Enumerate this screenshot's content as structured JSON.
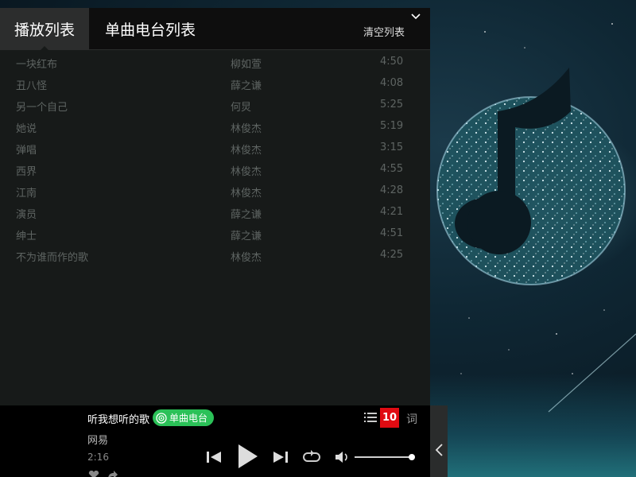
{
  "tabs": {
    "playlist": "播放列表",
    "radio": "单曲电台列表",
    "clear": "清空列表"
  },
  "songs": [
    {
      "title": "一块红布",
      "artist": "柳如萱",
      "duration": "4:50"
    },
    {
      "title": "丑八怪",
      "artist": "薛之谦",
      "duration": "4:08"
    },
    {
      "title": "另一个自己",
      "artist": "何炅",
      "duration": "5:25"
    },
    {
      "title": "她说",
      "artist": "林俊杰",
      "duration": "5:19"
    },
    {
      "title": "弹唱",
      "artist": "林俊杰",
      "duration": "3:15"
    },
    {
      "title": "西界",
      "artist": "林俊杰",
      "duration": "4:55"
    },
    {
      "title": "江南",
      "artist": "林俊杰",
      "duration": "4:28"
    },
    {
      "title": "演员",
      "artist": "薛之谦",
      "duration": "4:21"
    },
    {
      "title": "绅士",
      "artist": "薛之谦",
      "duration": "4:51"
    },
    {
      "title": "不为谁而作的歌",
      "artist": "林俊杰",
      "duration": "4:25"
    }
  ],
  "player": {
    "song_title": "听我想听的歌",
    "badge": "单曲电台",
    "artist": "网易",
    "time": "2:16",
    "playlist_count": "10",
    "lyric_label": "词",
    "volume": 0.9
  },
  "colors": {
    "accent_green": "#2bc158",
    "count_red": "#e00b12"
  },
  "icons": [
    "collapse-chevron-icon",
    "list-icon",
    "prev-icon",
    "play-icon",
    "next-icon",
    "repeat-icon",
    "volume-icon",
    "heart-icon",
    "share-icon",
    "chevron-left-icon",
    "radio-icon"
  ]
}
